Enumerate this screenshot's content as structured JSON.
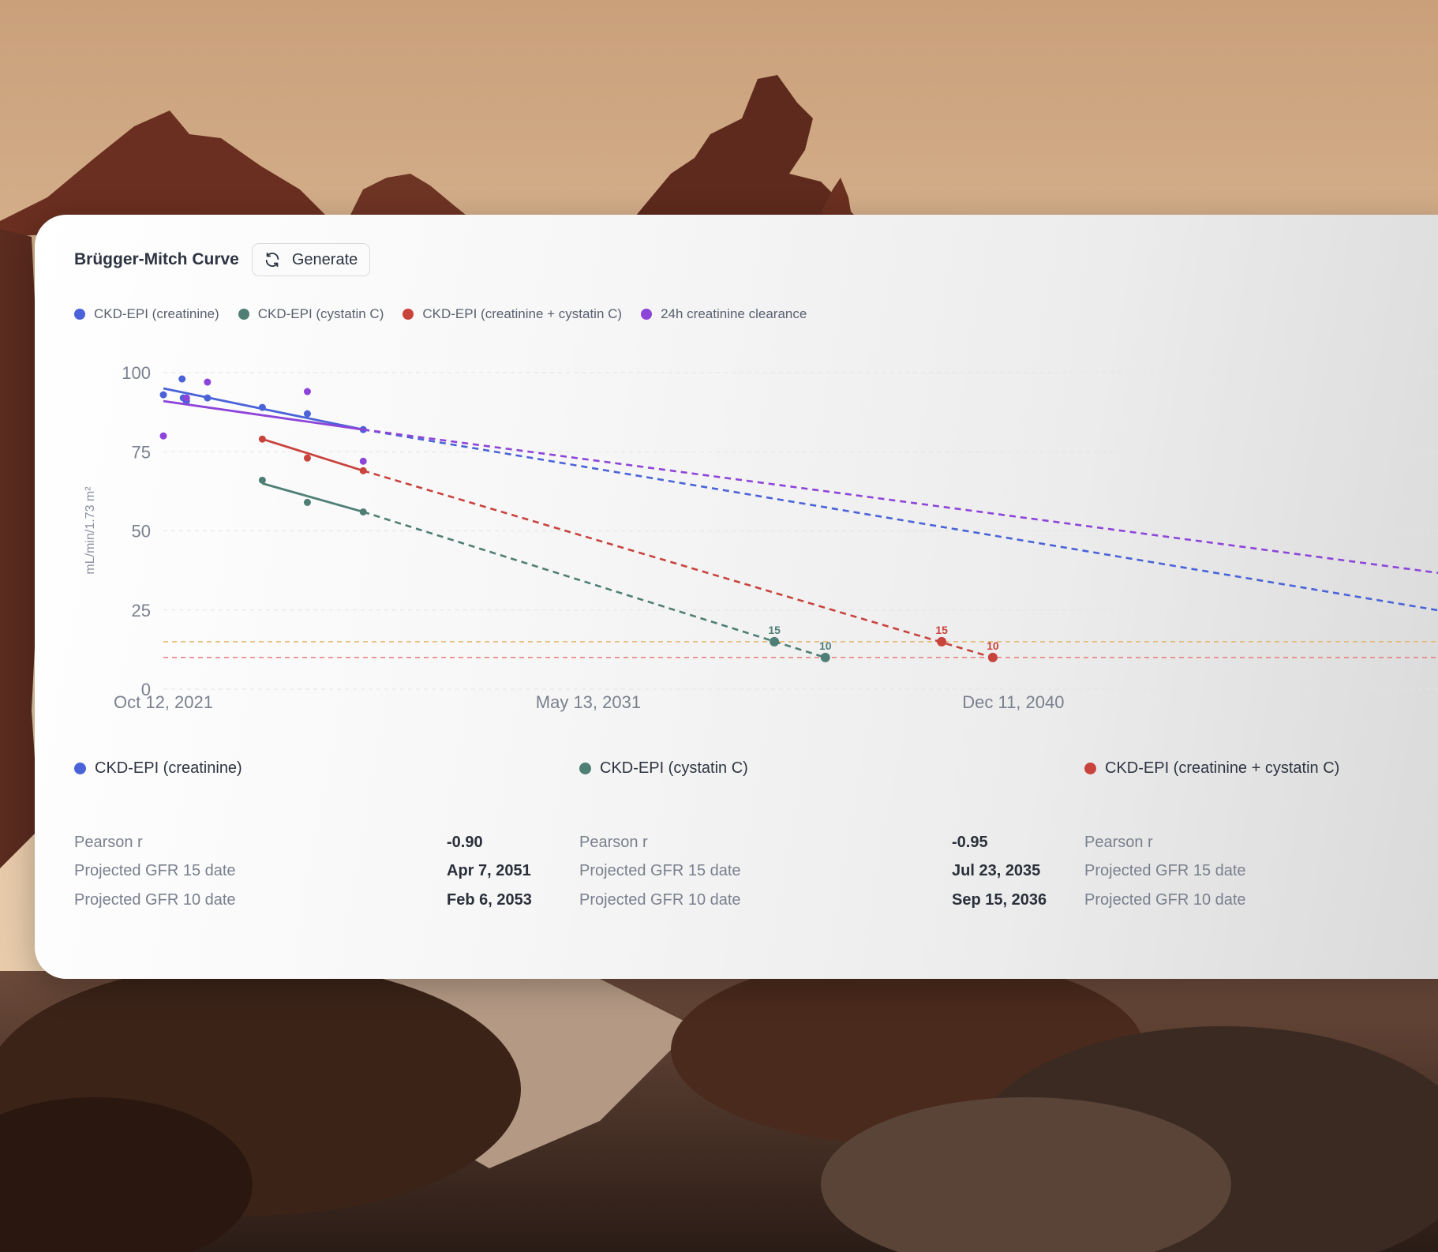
{
  "panel": {
    "title": "Brügger-Mitch Curve",
    "generate_label": "Generate"
  },
  "legend": [
    {
      "label": "CKD-EPI (creatinine)",
      "color": "#4a63d8"
    },
    {
      "label": "CKD-EPI (cystatin C)",
      "color": "#4f7f74"
    },
    {
      "label": "CKD-EPI (creatinine + cystatin C)",
      "color": "#c9433d"
    },
    {
      "label": "24h creatinine clearance",
      "color": "#8d45d9"
    }
  ],
  "chart_data": {
    "type": "scatter",
    "ylabel": "mL/min/1.73 m²",
    "ylim": [
      0,
      100
    ],
    "yticks": [
      0,
      25,
      50,
      75,
      100
    ],
    "xlim": [
      "2021-10-12",
      "2050-11-30"
    ],
    "xticks": [
      {
        "date": "2021-10-12",
        "label": "Oct 12, 2021"
      },
      {
        "date": "2031-05-13",
        "label": "May 13, 2031"
      },
      {
        "date": "2040-12-11",
        "label": "Dec 11, 2040"
      }
    ],
    "grid": true,
    "threshold_lines": [
      {
        "y": 15,
        "color": "#e6b56a"
      },
      {
        "y": 10,
        "color": "#e87a7a"
      }
    ],
    "series": [
      {
        "name": "CKD-EPI (creatinine)",
        "color": "#4a63d8",
        "points": [
          {
            "x": "2021-10-12",
            "y": 93
          },
          {
            "x": "2022-03-15",
            "y": 98
          },
          {
            "x": "2022-03-25",
            "y": 92
          },
          {
            "x": "2022-04-20",
            "y": 91
          },
          {
            "x": "2022-10-10",
            "y": 92
          },
          {
            "x": "2024-01-05",
            "y": 89
          },
          {
            "x": "2025-01-10",
            "y": 87
          },
          {
            "x": "2026-04-15",
            "y": 82
          }
        ],
        "fit": [
          {
            "x": "2021-10-12",
            "y": 95
          },
          {
            "x": "2026-04-15",
            "y": 82
          }
        ],
        "projection_end": {
          "x": "2050-11-30",
          "y": 24
        }
      },
      {
        "name": "CKD-EPI (cystatin C)",
        "color": "#4f7f74",
        "points": [
          {
            "x": "2024-01-05",
            "y": 66
          },
          {
            "x": "2025-01-10",
            "y": 59
          },
          {
            "x": "2026-04-15",
            "y": 56
          }
        ],
        "fit": [
          {
            "x": "2024-01-05",
            "y": 65
          },
          {
            "x": "2026-04-15",
            "y": 56
          }
        ],
        "projection_end": {
          "x": "2036-09-15",
          "y": 10
        },
        "markers": [
          {
            "x": "2035-07-23",
            "y": 15,
            "label": "15"
          },
          {
            "x": "2036-09-15",
            "y": 10,
            "label": "10"
          }
        ]
      },
      {
        "name": "CKD-EPI (creatinine + cystatin C)",
        "color": "#c9433d",
        "points": [
          {
            "x": "2024-01-05",
            "y": 79
          },
          {
            "x": "2025-01-10",
            "y": 73
          },
          {
            "x": "2026-04-15",
            "y": 69
          }
        ],
        "fit": [
          {
            "x": "2024-01-05",
            "y": 79
          },
          {
            "x": "2026-04-15",
            "y": 69
          }
        ],
        "projection_end": {
          "x": "2040-06-25",
          "y": 10
        },
        "markers": [
          {
            "x": "2039-05-01",
            "y": 15,
            "label": "15"
          },
          {
            "x": "2040-06-25",
            "y": 10,
            "label": "10"
          }
        ]
      },
      {
        "name": "24h creatinine clearance",
        "color": "#8d45d9",
        "points": [
          {
            "x": "2021-10-12",
            "y": 80
          },
          {
            "x": "2022-04-20",
            "y": 92
          },
          {
            "x": "2022-10-10",
            "y": 97
          },
          {
            "x": "2025-01-10",
            "y": 94
          },
          {
            "x": "2026-04-15",
            "y": 72
          }
        ],
        "fit": [
          {
            "x": "2021-10-12",
            "y": 91
          },
          {
            "x": "2026-04-15",
            "y": 82
          }
        ],
        "projection_end": {
          "x": "2050-11-30",
          "y": 36
        }
      }
    ]
  },
  "stats": [
    {
      "name": "CKD-EPI (creatinine)",
      "color": "#4a63d8",
      "rows": [
        {
          "label": "Pearson r",
          "value": "-0.90"
        },
        {
          "label": "Projected GFR 15 date",
          "value": "Apr 7, 2051"
        },
        {
          "label": "Projected GFR 10 date",
          "value": "Feb 6, 2053"
        }
      ]
    },
    {
      "name": "CKD-EPI (cystatin C)",
      "color": "#4f7f74",
      "rows": [
        {
          "label": "Pearson r",
          "value": "-0.95"
        },
        {
          "label": "Projected GFR 15 date",
          "value": "Jul 23, 2035"
        },
        {
          "label": "Projected GFR 10 date",
          "value": "Sep 15, 2036"
        }
      ]
    },
    {
      "name": "CKD-EPI (creatinine + cystatin C)",
      "color": "#c9433d",
      "rows": [
        {
          "label": "Pearson r",
          "value": ""
        },
        {
          "label": "Projected GFR 15 date",
          "value": ""
        },
        {
          "label": "Projected GFR 10 date",
          "value": ""
        }
      ]
    }
  ]
}
